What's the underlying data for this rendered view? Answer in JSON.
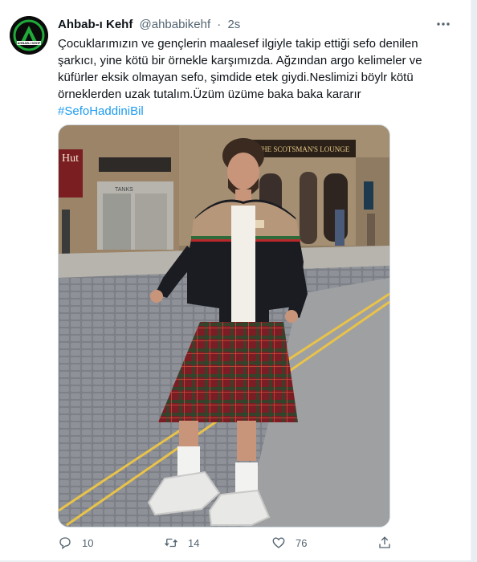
{
  "tweet": {
    "display_name": "Ahbab-ı Kehf",
    "handle": "@ahbabikehf",
    "separator": "·",
    "time": "2s",
    "avatar_text": "AHBAB-I KEHF",
    "text": "Çocuklarımızın ve gençlerin maalesef ilgiyle takip ettiği sefo denilen şarkıcı, yine kötü bir örnekle karşımızda. Ağzından argo kelimeler ve küfürler eksik olmayan sefo, şimdide etek giydi.Neslimizi böylr kötü örneklerden uzak tutalım.Üzüm üzüme baka baka kararır",
    "hashtag": "#SefoHaddiniBil",
    "more_icon": "more-horizontal-icon"
  },
  "photo": {
    "sign_text": "THE SCOTSMAN'S LOUNGE",
    "left_sign": "Hut",
    "shop_sign": "TANKS"
  },
  "actions": {
    "reply_count": "10",
    "retweet_count": "14",
    "like_count": "76",
    "icons": [
      "reply-icon",
      "retweet-icon",
      "like-icon",
      "share-icon"
    ]
  },
  "colors": {
    "link": "#1d9bf0",
    "muted": "#536471",
    "text": "#0f1419",
    "avatar_green": "#1faa3a"
  }
}
